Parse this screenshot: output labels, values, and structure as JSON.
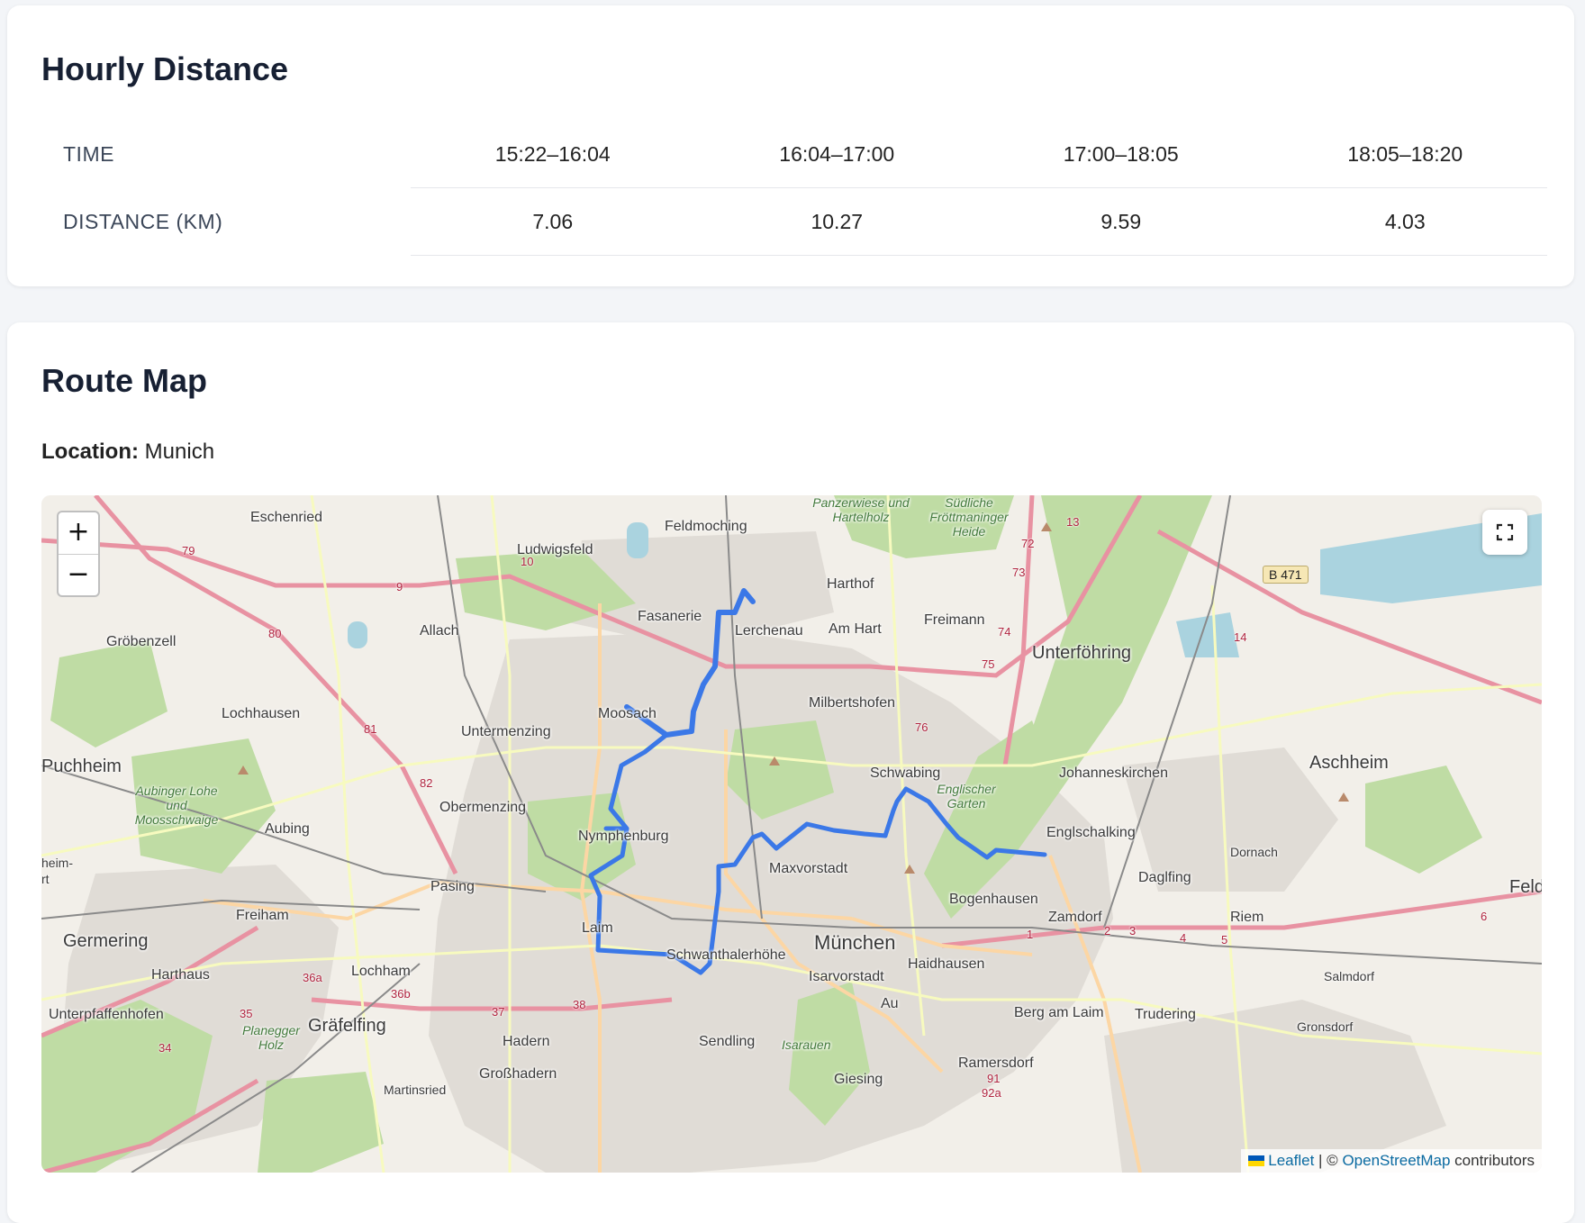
{
  "hourly": {
    "title": "Hourly Distance",
    "time_label": "TIME",
    "distance_label": "DISTANCE (KM)",
    "columns": [
      {
        "time": "15:22–16:04",
        "distance": "7.06"
      },
      {
        "time": "16:04–17:00",
        "distance": "10.27"
      },
      {
        "time": "17:00–18:05",
        "distance": "9.59"
      },
      {
        "time": "18:05–18:20",
        "distance": "4.03"
      }
    ]
  },
  "route_map": {
    "title": "Route Map",
    "location_label": "Location:",
    "location_value": "Munich",
    "zoom_in": "+",
    "zoom_out": "−",
    "attribution": {
      "leaflet": "Leaflet",
      "separator": " | © ",
      "osm": "OpenStreetMap",
      "suffix": " contributors"
    },
    "route_color": "#3b78e7",
    "places": [
      "Eschenried",
      "Feldmoching",
      "Ludwigsfeld",
      "Panzerwiese und Hartelholz",
      "Südliche Fröttmaninger Heide",
      "Harthof",
      "Fasanerie",
      "Lerchenau",
      "Am Hart",
      "Freimann",
      "Gröbenzell",
      "Allach",
      "Unterföhring",
      "Lochhausen",
      "Moosach",
      "Milbertshofen",
      "Untermenzing",
      "Puchheim",
      "Schwabing",
      "Englischer Garten",
      "Johanneskirchen",
      "Aschheim",
      "Aubinger Lohe und Moosschwaige",
      "Obermenzing",
      "Nymphenburg",
      "Aubing",
      "Englschalking",
      "Dornach",
      "Maxvorstadt",
      "Daglfing",
      "Pasing",
      "Bogenhausen",
      "Freiham",
      "Zamdorf",
      "Riem",
      "Laim",
      "Germering",
      "München",
      "Harthaus",
      "Lochham",
      "Schwanthalerhöhe",
      "Haidhausen",
      "Isarvorstadt",
      "Salmdorf",
      "Au",
      "Unterpfaffenhofen",
      "Gräfelfing",
      "Berg am Laim",
      "Trudering",
      "Planegger Holz",
      "Hadern",
      "Sendling",
      "Gronsdorf",
      "Isarauen",
      "Ramersdorf",
      "Großhadern",
      "Giesing",
      "Martinsried",
      "heim-",
      "rt",
      "Feld"
    ],
    "road_numbers": [
      "B 471",
      "79",
      "80",
      "81",
      "82",
      "9",
      "10",
      "13",
      "72",
      "73",
      "74",
      "75",
      "76",
      "14",
      "36a",
      "36b",
      "37",
      "38",
      "34",
      "35",
      "1",
      "2",
      "3",
      "4",
      "5",
      "6",
      "91",
      "92a"
    ]
  }
}
